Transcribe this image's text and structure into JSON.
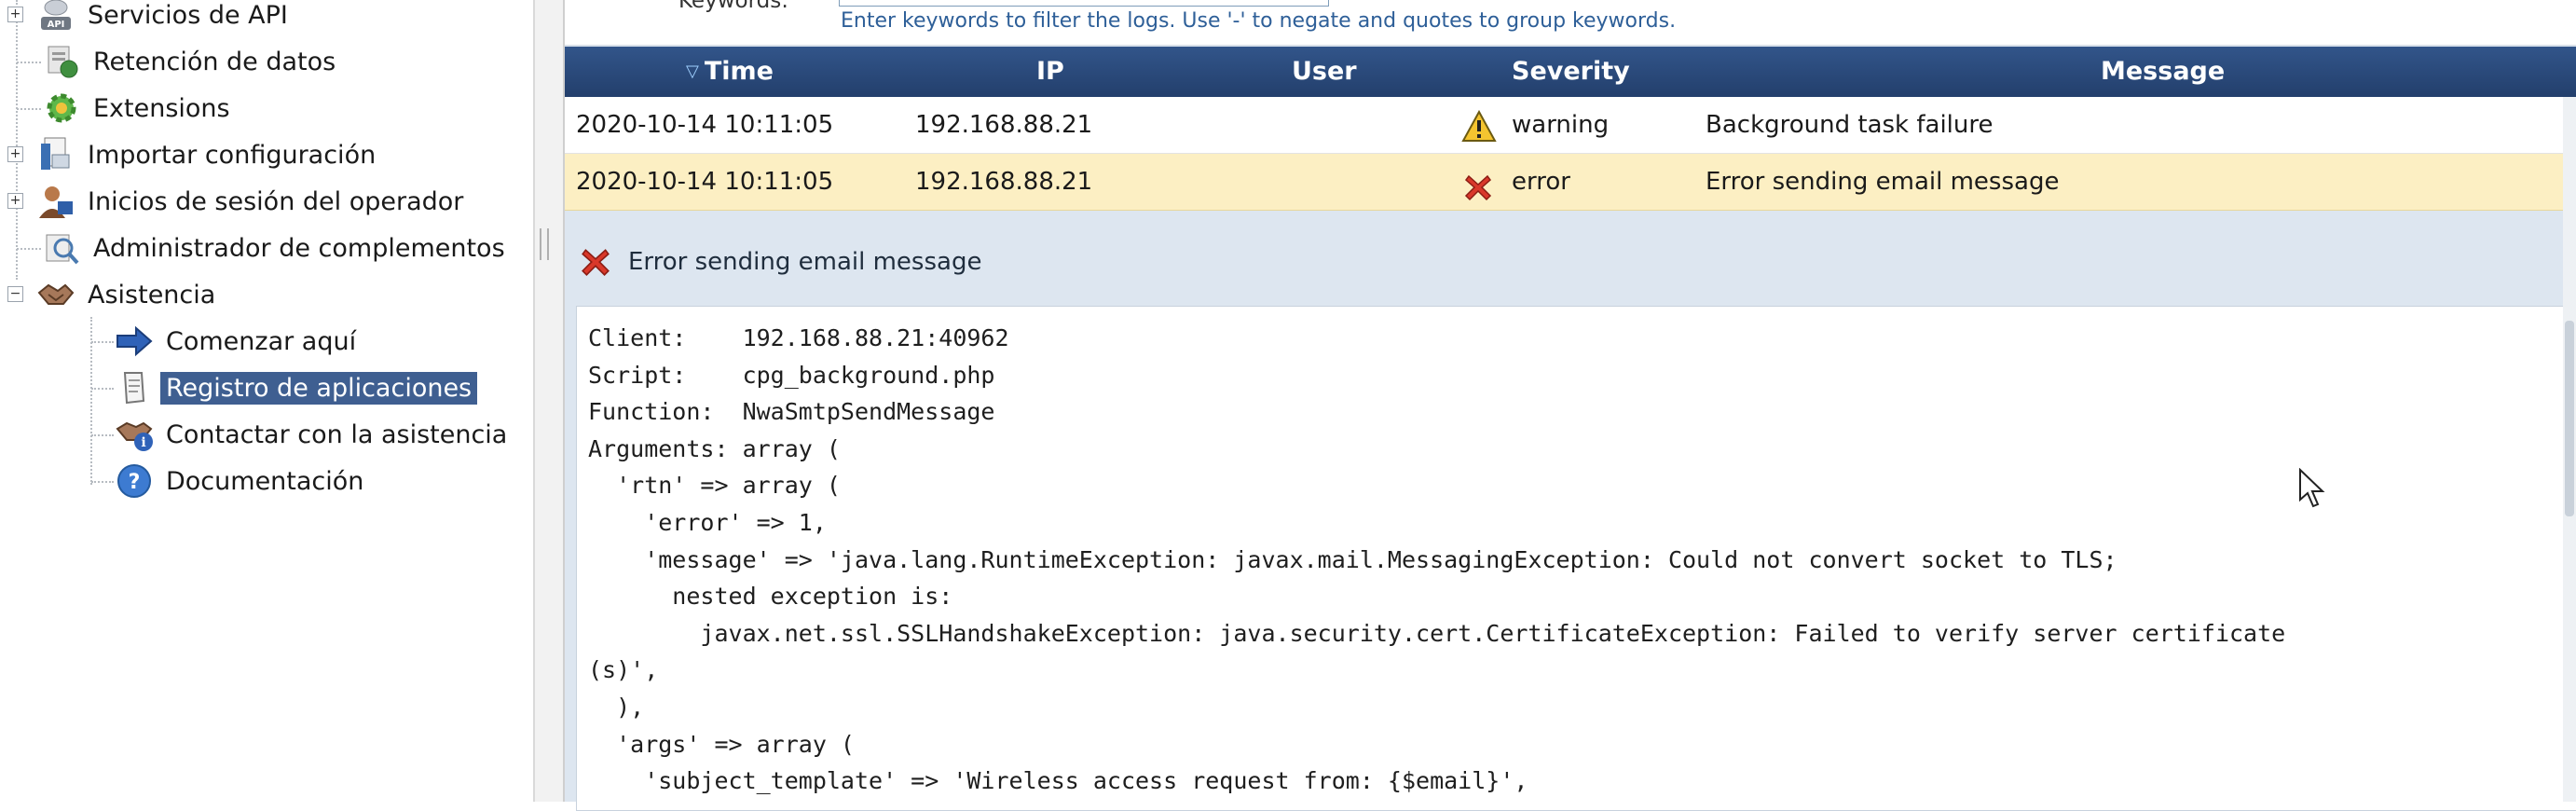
{
  "tree": {
    "items": [
      {
        "label": "Servicios de API",
        "icon": "api-icon",
        "expander": "+"
      },
      {
        "label": "Retención de datos",
        "icon": "data-retention-icon",
        "expander": ""
      },
      {
        "label": "Extensions",
        "icon": "extensions-gear-icon",
        "expander": ""
      },
      {
        "label": "Importar configuración",
        "icon": "import-config-icon",
        "expander": "+"
      },
      {
        "label": "Inicios de sesión del operador",
        "icon": "operator-login-icon",
        "expander": "+"
      },
      {
        "label": "Administrador de complementos",
        "icon": "plugin-manager-icon",
        "expander": ""
      },
      {
        "label": "Asistencia",
        "icon": "support-handshake-icon",
        "expander": "−"
      },
      {
        "label": "Comenzar aquí",
        "icon": "arrow-right-icon",
        "expander": ""
      },
      {
        "label": "Registro de aplicaciones",
        "icon": "app-log-icon",
        "expander": "",
        "selected": true
      },
      {
        "label": "Contactar con la asistencia",
        "icon": "contact-support-icon",
        "expander": ""
      },
      {
        "label": "Documentación",
        "icon": "help-question-icon",
        "expander": ""
      }
    ]
  },
  "filter": {
    "label": "Keywords:",
    "value": "",
    "hint": "Enter keywords to filter the logs. Use '-' to negate and quotes to group keywords."
  },
  "grid": {
    "columns": {
      "time": "Time",
      "ip": "IP",
      "user": "User",
      "severity": "Severity",
      "message": "Message"
    },
    "sort_column": "time",
    "rows": [
      {
        "time": "2020-10-14 10:11:05",
        "ip": "192.168.88.21",
        "user": "",
        "severity": "warning",
        "severity_icon": "warning-triangle-icon",
        "message": "Background task failure"
      },
      {
        "time": "2020-10-14 10:11:05",
        "ip": "192.168.88.21",
        "user": "",
        "severity": "error",
        "severity_icon": "error-x-icon",
        "message": "Error sending email message",
        "selected": true
      }
    ]
  },
  "detail": {
    "title": "Error sending email message",
    "icon": "error-x-icon",
    "lines": [
      "Client:    192.168.88.21:40962",
      "Script:    cpg_background.php",
      "Function:  NwaSmtpSendMessage",
      "Arguments: array (",
      "  'rtn' => array (",
      "    'error' => 1,",
      "    'message' => 'java.lang.RuntimeException: javax.mail.MessagingException: Could not convert socket to TLS;",
      "      nested exception is:",
      "        javax.net.ssl.SSLHandshakeException: java.security.cert.CertificateException: Failed to verify server certificate",
      "(s)',",
      "  ),",
      "  'args' => array (",
      "    'subject_template' => 'Wireless access request from: {$email}',"
    ]
  },
  "colors": {
    "header_bg": "#2a4a7c",
    "selected_row": "#fcefc3",
    "tree_selected": "#3f5f91",
    "hint_text": "#2e5f98"
  }
}
